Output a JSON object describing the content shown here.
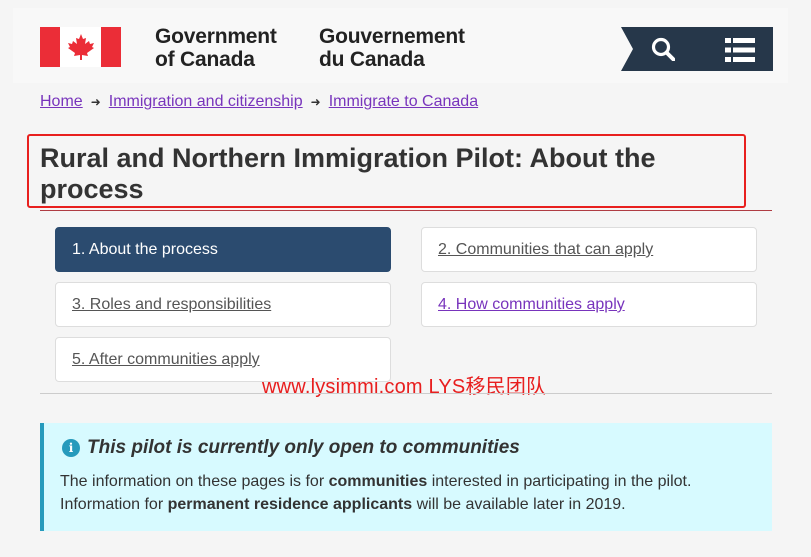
{
  "header": {
    "wordmark_en_line1": "Government",
    "wordmark_en_line2": "of Canada",
    "wordmark_fr_line1": "Gouvernement",
    "wordmark_fr_line2": "du Canada",
    "brand_color": "#26374a",
    "flag_red": "#eb2d37"
  },
  "breadcrumb": {
    "items": [
      "Home",
      "Immigration and citizenship",
      "Immigrate to Canada"
    ]
  },
  "page": {
    "title": "Rural and Northern Immigration Pilot: About the process"
  },
  "tabs": [
    {
      "label": "1. About the process",
      "active": true
    },
    {
      "label": "2. Communities that can apply",
      "active": false
    },
    {
      "label": "3. Roles and responsibilities",
      "active": false
    },
    {
      "label": "4. How communities apply",
      "active": false,
      "visited": true
    },
    {
      "label": "5. After communities apply",
      "active": false
    }
  ],
  "watermark": "www.lysimmi.com  LYS移民团队",
  "alert": {
    "icon": "i",
    "title": "This pilot is currently only open to communities",
    "line1_pre": "The information on these pages is for ",
    "line1_bold": "communities",
    "line1_post": " interested in participating in the pilot.",
    "line2_pre": "Information for ",
    "line2_bold": "permanent residence applicants",
    "line2_post": " will be available later in 2019."
  }
}
